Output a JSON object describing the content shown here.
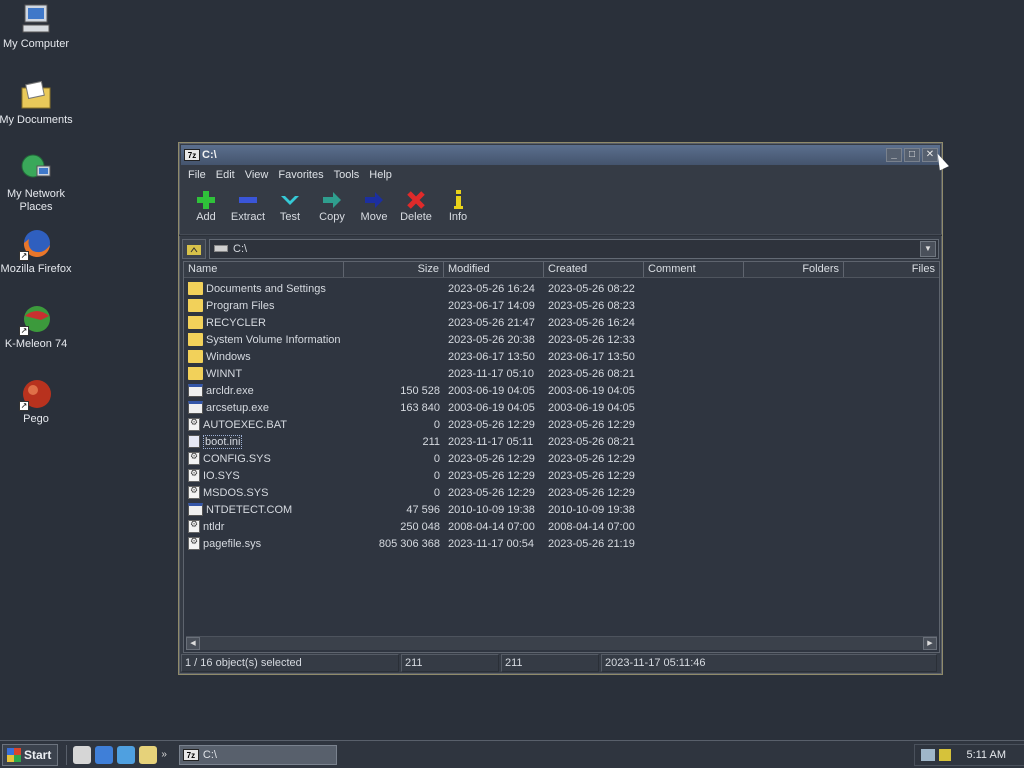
{
  "desktop": {
    "icons": [
      {
        "label": "My Computer"
      },
      {
        "label": "My Documents"
      },
      {
        "label": "My Network Places"
      },
      {
        "label": "Mozilla Firefox"
      },
      {
        "label": "K-Meleon 74"
      },
      {
        "label": "Pego"
      }
    ]
  },
  "window": {
    "app_icon": "7z",
    "title": "C:\\",
    "menu": [
      "File",
      "Edit",
      "View",
      "Favorites",
      "Tools",
      "Help"
    ],
    "toolbar": [
      {
        "label": "Add",
        "icon": "plus-icon",
        "color": "#2fc23a"
      },
      {
        "label": "Extract",
        "icon": "minus-icon",
        "color": "#3a55d8"
      },
      {
        "label": "Test",
        "icon": "check-chevron-icon",
        "color": "#35c9d6"
      },
      {
        "label": "Copy",
        "icon": "copy-arrow-icon",
        "color": "#2f9e8e"
      },
      {
        "label": "Move",
        "icon": "move-arrow-icon",
        "color": "#1c2fa0"
      },
      {
        "label": "Delete",
        "icon": "delete-x-icon",
        "color": "#e02a2a"
      },
      {
        "label": "Info",
        "icon": "info-icon",
        "color": "#e8d21a"
      }
    ],
    "address": "C:\\",
    "columns": [
      "Name",
      "Size",
      "Modified",
      "Created",
      "Comment",
      "Folders",
      "Files"
    ],
    "rows": [
      {
        "name": "Documents and Settings",
        "type": "folder",
        "size": "",
        "modified": "2023-05-26 16:24",
        "created": "2023-05-26 08:22"
      },
      {
        "name": "Program Files",
        "type": "folder",
        "size": "",
        "modified": "2023-06-17 14:09",
        "created": "2023-05-26 08:23"
      },
      {
        "name": "RECYCLER",
        "type": "folder",
        "size": "",
        "modified": "2023-05-26 21:47",
        "created": "2023-05-26 16:24"
      },
      {
        "name": "System Volume Information",
        "type": "folder",
        "size": "",
        "modified": "2023-05-26 20:38",
        "created": "2023-05-26 12:33"
      },
      {
        "name": "Windows",
        "type": "folder",
        "size": "",
        "modified": "2023-06-17 13:50",
        "created": "2023-06-17 13:50"
      },
      {
        "name": "WINNT",
        "type": "folder",
        "size": "",
        "modified": "2023-11-17 05:10",
        "created": "2023-05-26 08:21"
      },
      {
        "name": "arcldr.exe",
        "type": "exe",
        "size": "150 528",
        "modified": "2003-06-19 04:05",
        "created": "2003-06-19 04:05"
      },
      {
        "name": "arcsetup.exe",
        "type": "exe",
        "size": "163 840",
        "modified": "2003-06-19 04:05",
        "created": "2003-06-19 04:05"
      },
      {
        "name": "AUTOEXEC.BAT",
        "type": "sys",
        "size": "0",
        "modified": "2023-05-26 12:29",
        "created": "2023-05-26 12:29"
      },
      {
        "name": "boot.ini",
        "type": "ini",
        "size": "211",
        "modified": "2023-11-17 05:11",
        "created": "2023-05-26 08:21",
        "selected": true
      },
      {
        "name": "CONFIG.SYS",
        "type": "sys",
        "size": "0",
        "modified": "2023-05-26 12:29",
        "created": "2023-05-26 12:29"
      },
      {
        "name": "IO.SYS",
        "type": "sys",
        "size": "0",
        "modified": "2023-05-26 12:29",
        "created": "2023-05-26 12:29"
      },
      {
        "name": "MSDOS.SYS",
        "type": "sys",
        "size": "0",
        "modified": "2023-05-26 12:29",
        "created": "2023-05-26 12:29"
      },
      {
        "name": "NTDETECT.COM",
        "type": "exe",
        "size": "47 596",
        "modified": "2010-10-09 19:38",
        "created": "2010-10-09 19:38"
      },
      {
        "name": "ntldr",
        "type": "sys",
        "size": "250 048",
        "modified": "2008-04-14 07:00",
        "created": "2008-04-14 07:00"
      },
      {
        "name": "pagefile.sys",
        "type": "sys",
        "size": "805 306 368",
        "modified": "2023-11-17 00:54",
        "created": "2023-05-26 21:19"
      }
    ],
    "status": {
      "selection": "1 / 16 object(s) selected",
      "size": "211",
      "packed": "211",
      "date": "2023-11-17 05:11:46"
    }
  },
  "taskbar": {
    "start_label": "Start",
    "task_label": "C:\\",
    "task_icon": "7z",
    "clock": "5:11 AM"
  }
}
